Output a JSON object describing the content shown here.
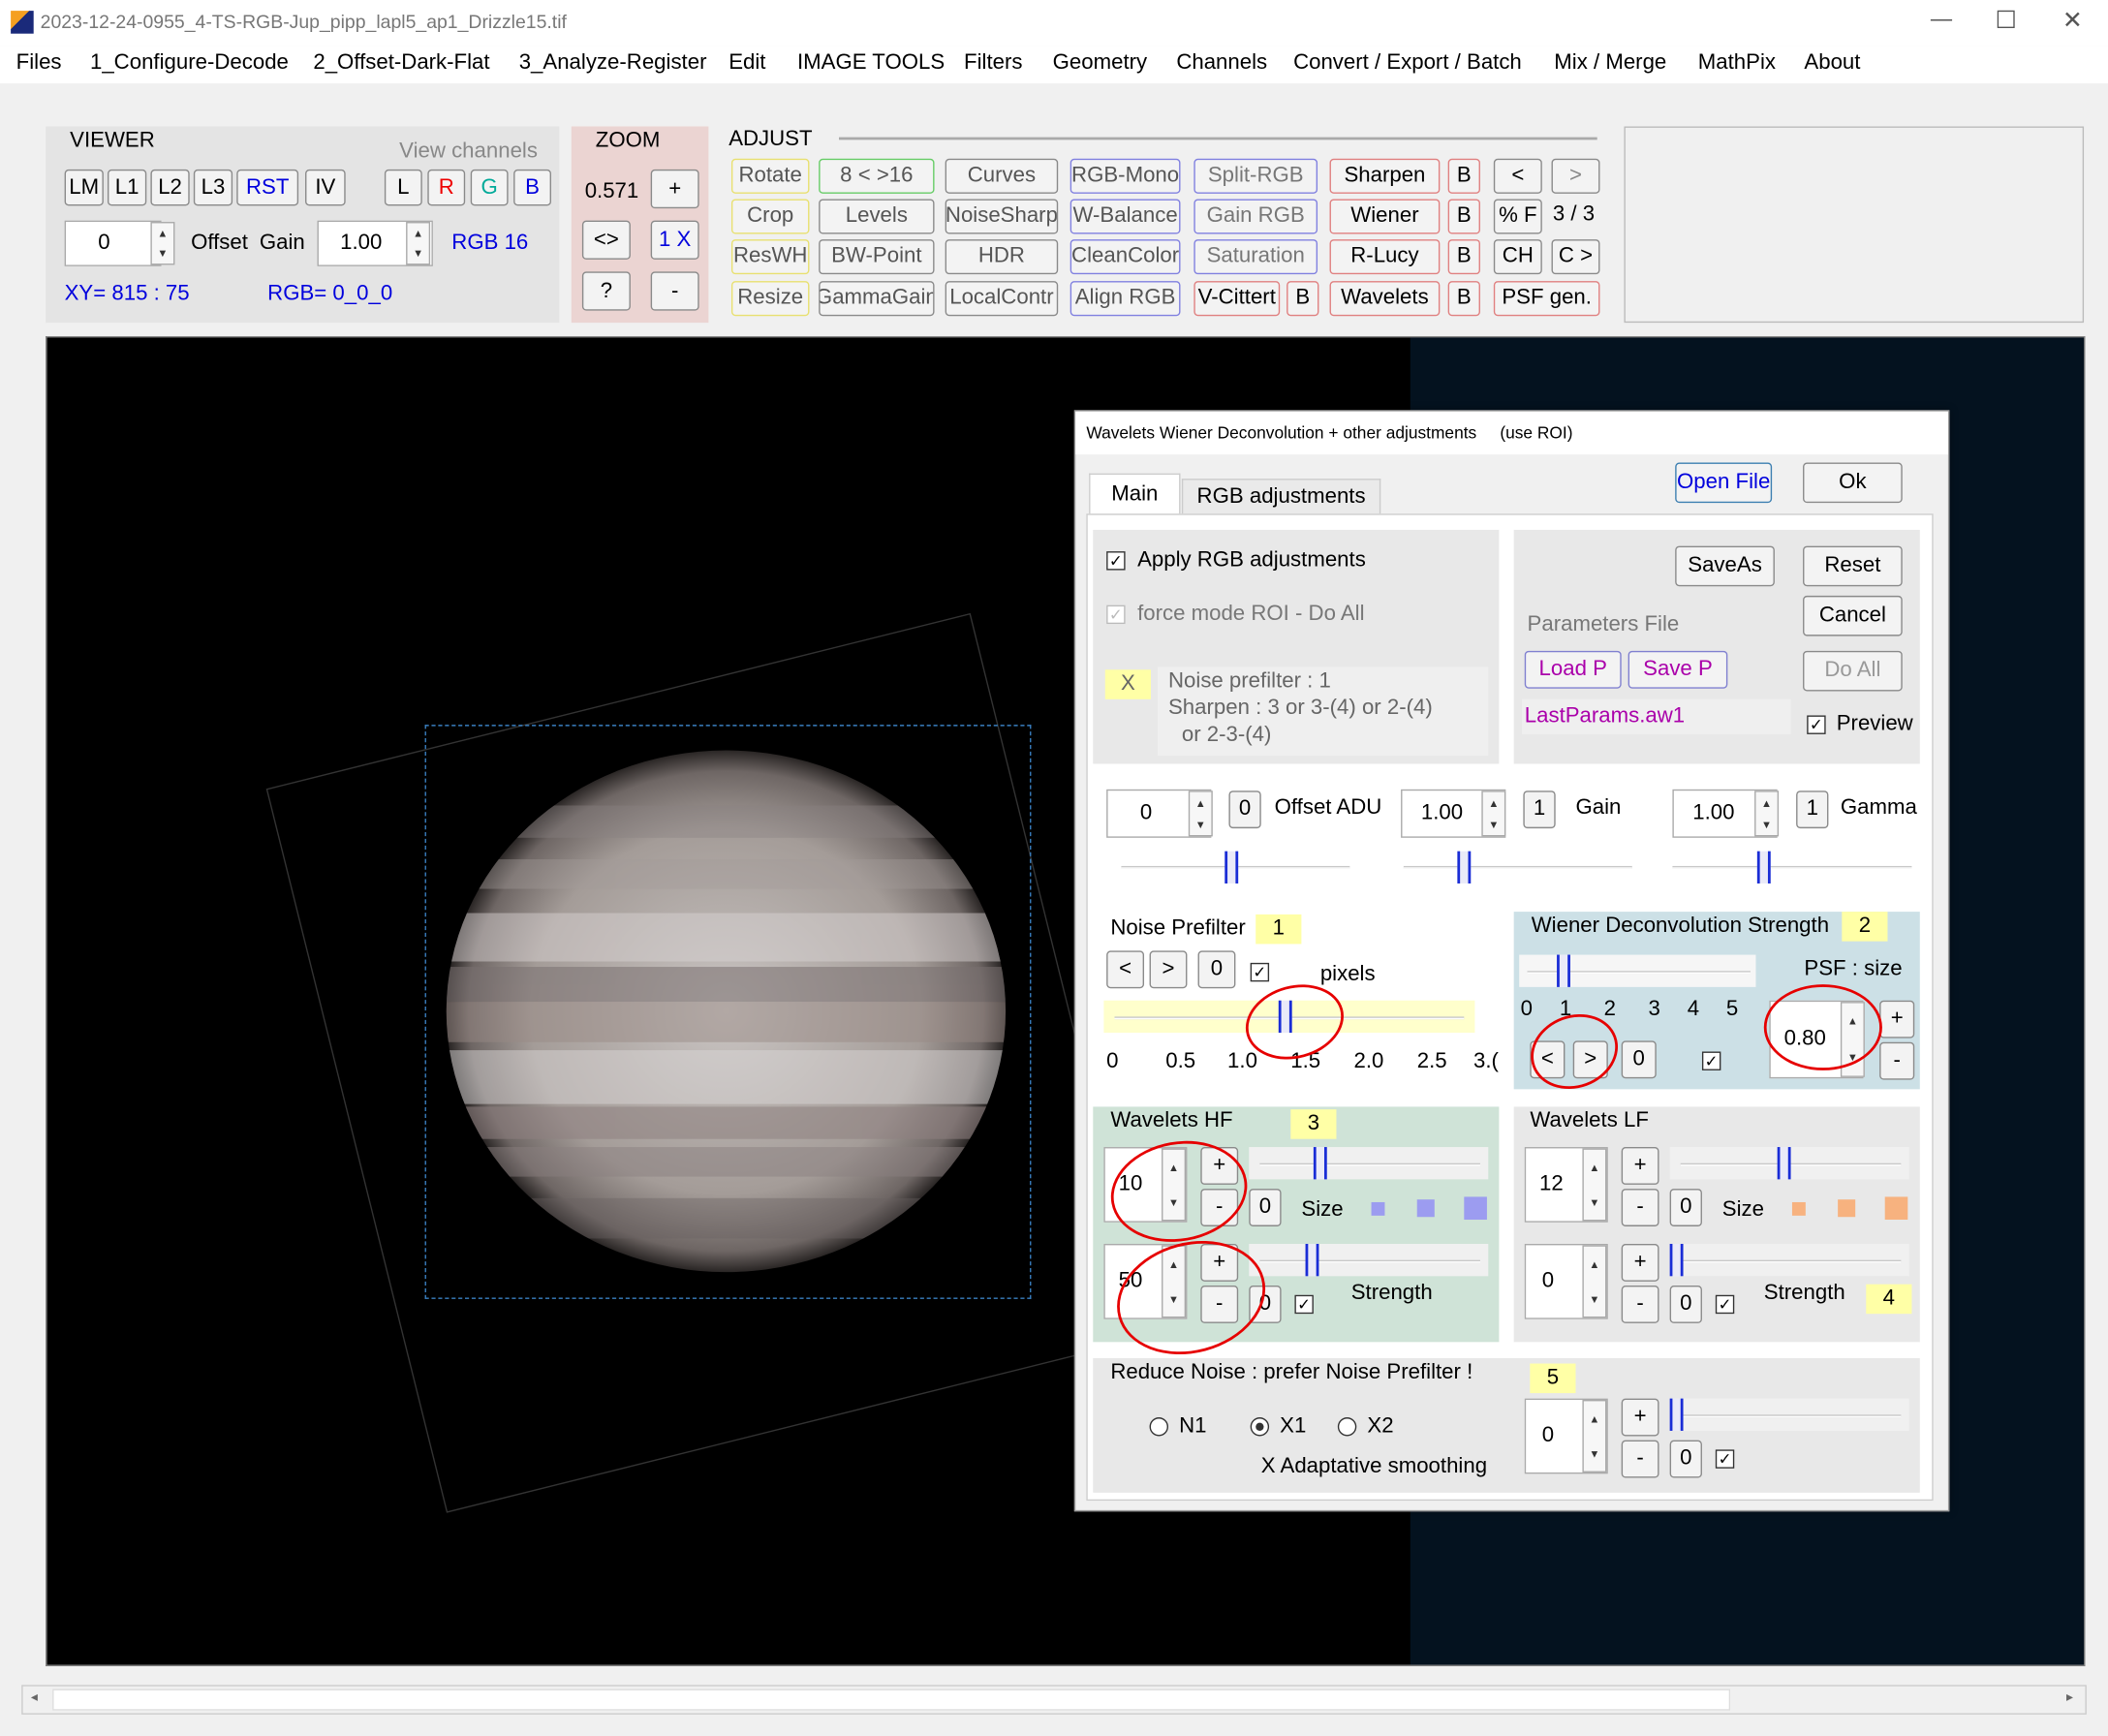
{
  "window": {
    "title": "2023-12-24-0955_4-TS-RGB-Jup_pipp_lapl5_ap1_Drizzle15.tif",
    "min": "—",
    "max": "☐",
    "close": "✕"
  },
  "menu": [
    "Files",
    "1_Configure-Decode",
    "2_Offset-Dark-Flat",
    "3_Analyze-Register",
    "Edit",
    "IMAGE TOOLS",
    "Filters",
    "Geometry",
    "Channels",
    "Convert / Export / Batch",
    "Mix / Merge",
    "MathPix",
    "About"
  ],
  "viewer": {
    "title": "VIEWER",
    "channels_label": "View channels",
    "buttons": [
      "LM",
      "L1",
      "L2",
      "L3",
      "RST",
      "IV"
    ],
    "channel_buttons": [
      "L",
      "R",
      "G",
      "B"
    ],
    "offset_value": "0",
    "offset_label": "Offset",
    "gain_label": "Gain",
    "gain_value": "1.00",
    "rgb_mode": "RGB 16",
    "xy": "XY=  815 : 75",
    "rgb": "RGB=  0_0_0"
  },
  "zoom": {
    "title": "ZOOM",
    "value": "0.571",
    "plus": "+",
    "fit": "<>",
    "one": "1 X",
    "help": "?",
    "minus": "-"
  },
  "adjust": {
    "title": "ADJUST",
    "col1": [
      "Rotate",
      "Crop",
      "ResWH",
      "Resize"
    ],
    "col2": [
      "8 < >16",
      "Levels",
      "BW-Point",
      "GammaGain"
    ],
    "col3": [
      "Curves",
      "NoiseSharp",
      "HDR",
      "LocalContr"
    ],
    "col4": [
      "RGB-Mono",
      "W-Balance",
      "CleanColor",
      "Align RGB"
    ],
    "col5": [
      "Split-RGB",
      "Gain RGB",
      "Saturation",
      "V-Cittert"
    ],
    "col6": [
      "Sharpen",
      "Wiener",
      "R-Lucy",
      "Wavelets"
    ],
    "b": "B",
    "prev": "<",
    "next": ">",
    "pct": "% F",
    "page": "3 / 3",
    "ch": "CH",
    "c_next": "C >",
    "psf": "PSF gen."
  },
  "dialog": {
    "title": "Wavelets Wiener Deconvolution + other adjustments     (use ROI)",
    "tabs": [
      "Main",
      "RGB adjustments"
    ],
    "open_file": "Open File",
    "ok": "Ok",
    "apply_rgb": "Apply RGB adjustments",
    "force_mode": "force mode  ROI - Do All",
    "x_mark": "X",
    "prefilter_note1": "Noise prefilter :  1",
    "prefilter_note2": "Sharpen :   3  or  3-(4)  or  2-(4)",
    "prefilter_note3": "or  2-3-(4)",
    "save_as": "SaveAs",
    "reset": "Reset",
    "cancel": "Cancel",
    "do_all": "Do All",
    "params_label": "Parameters File",
    "load_p": "Load P",
    "save_p": "Save P",
    "params_file": "LastParams.aw1",
    "preview": "Preview",
    "offset_value": "0",
    "offset_label": "Offset ADU",
    "gain_value": "1.00",
    "gain_label": "Gain",
    "gamma_value": "1.00",
    "gamma_label": "Gamma",
    "zero": "0",
    "one": "1",
    "noise_title": "Noise Prefilter",
    "noise_num": "1",
    "pixels": "pixels",
    "noise_scale": [
      "0",
      "0.5",
      "1.0",
      "1.5",
      "2.0",
      "2.5",
      "3.("
    ],
    "wiener_title": "Wiener Deconvolution Strength",
    "wiener_num": "2",
    "psf_label": "PSF : size",
    "wiener_scale": [
      "0",
      "1",
      "2",
      "3",
      "4",
      "5"
    ],
    "psf_value": "0.80",
    "whf_title": "Wavelets HF",
    "whf_num": "3",
    "whf_size": "10",
    "whf_strength": "50",
    "size_label": "Size",
    "strength_label": "Strength",
    "wlf_title": "Wavelets LF",
    "wlf_size": "12",
    "wlf_strength": "0",
    "wlf_num": "4",
    "reduce_title": "Reduce Noise :  prefer Noise Prefilter !",
    "reduce_num": "5",
    "radios": [
      "N1",
      "X1",
      "X2"
    ],
    "adaptive": "X Adaptative smoothing",
    "reduce_value": "0"
  }
}
